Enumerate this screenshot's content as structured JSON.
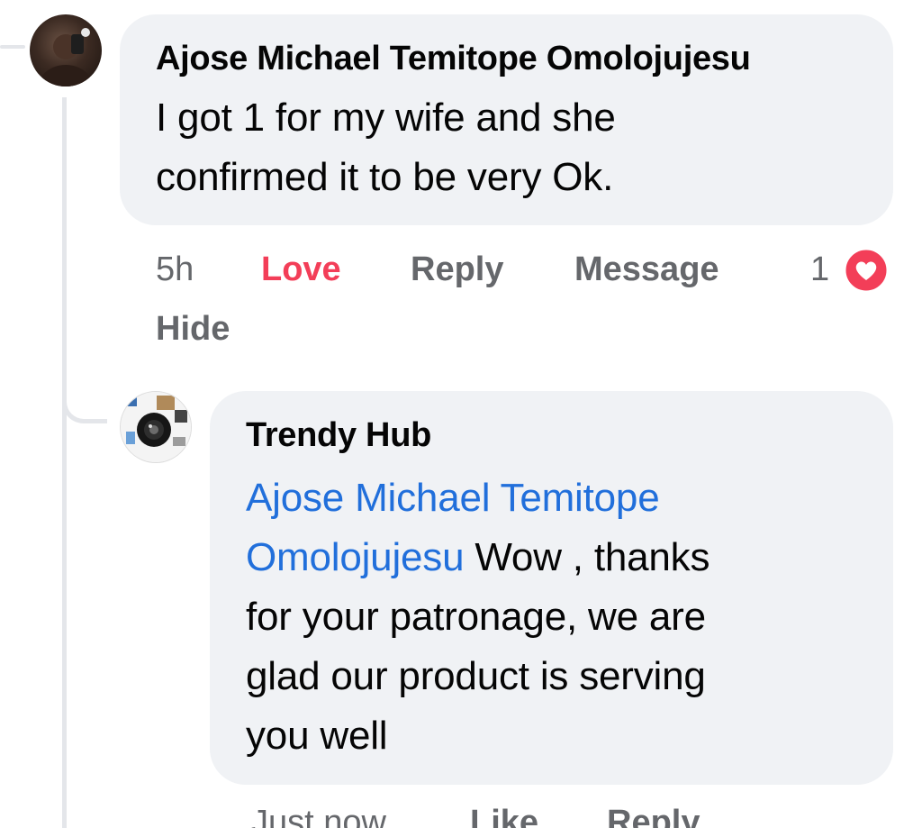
{
  "comment": {
    "author": "Ajose Michael Temitope Omolojujesu",
    "text_line1": "I got 1 for my wife and she",
    "text_line2": "confirmed it to be very Ok.",
    "time": "5h",
    "love_label": "Love",
    "reply_label": "Reply",
    "message_label": "Message",
    "reaction_count": "1",
    "hide_label": "Hide",
    "love_color": "#f33e58"
  },
  "reply": {
    "author": "Trendy Hub",
    "mention_line1": "Ajose Michael Temitope",
    "mention_line2": "Omolojujesu",
    "text_line2": " Wow , thanks",
    "text_line3": "for your patronage, we are",
    "text_line4": "glad our product is serving",
    "text_line5": "you well",
    "time": "Just now",
    "like_label": "Like",
    "reply_label": "Reply"
  },
  "icons": {
    "reaction": "heart-icon",
    "avatar1": "user-photo",
    "avatar2": "camera-product-avatar"
  },
  "colors": {
    "bubble": "#f0f2f5",
    "mention": "#216fdb",
    "meta": "#65676b"
  }
}
